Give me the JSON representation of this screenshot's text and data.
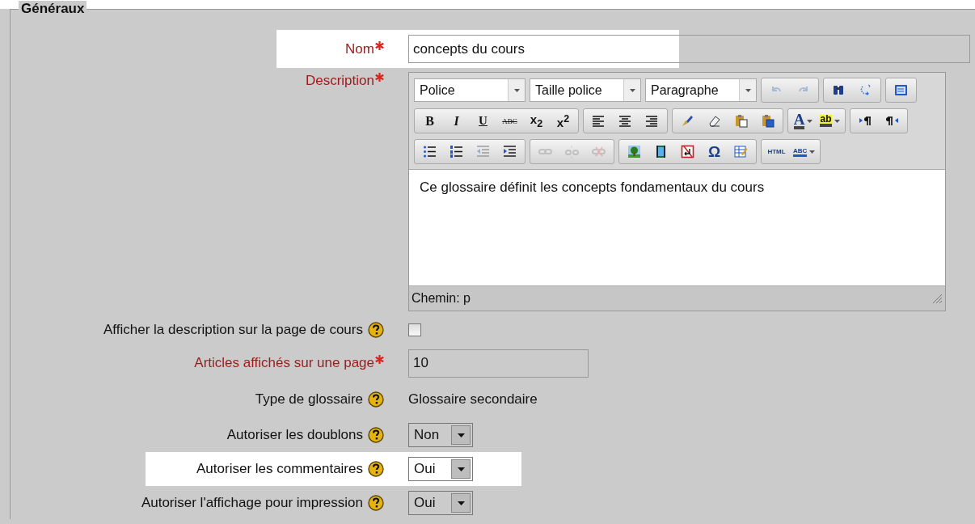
{
  "fieldset": {
    "legend": "Généraux"
  },
  "rows": [
    {
      "kind": "text",
      "label": "Nom",
      "required": true,
      "help": false,
      "highlighted": true,
      "value": "concepts du cours"
    },
    {
      "kind": "editor",
      "label": "Description",
      "required": true,
      "help": false,
      "highlighted": false,
      "editor": {
        "toolbar": [
          [
            {
              "kind": "select",
              "label": "Police"
            },
            {
              "kind": "select",
              "label": "Taille police"
            },
            {
              "kind": "select",
              "label": "Paragraphe"
            },
            {
              "kind": "group",
              "buttons": [
                {
                  "kind": "icon",
                  "disabled": true,
                  "menu": false
                },
                {
                  "kind": "icon",
                  "disabled": true,
                  "menu": false
                }
              ]
            },
            {
              "kind": "group",
              "buttons": [
                {
                  "kind": "icon",
                  "disabled": false,
                  "menu": false
                },
                {
                  "kind": "icon",
                  "disabled": false,
                  "menu": false
                }
              ]
            },
            {
              "kind": "group",
              "buttons": [
                {
                  "kind": "icon",
                  "disabled": false,
                  "menu": false
                }
              ]
            }
          ],
          [
            {
              "kind": "group",
              "buttons": [
                {
                  "kind": "text",
                  "label": "B",
                  "disabled": false,
                  "menu": false
                },
                {
                  "kind": "text",
                  "label": "I",
                  "disabled": false,
                  "menu": false
                },
                {
                  "kind": "text",
                  "label": "U",
                  "disabled": false,
                  "menu": false
                },
                {
                  "kind": "text",
                  "label": "ABC",
                  "disabled": false,
                  "menu": false
                },
                {
                  "kind": "text",
                  "label": "x$_{2}$",
                  "disabled": false,
                  "menu": false
                },
                {
                  "kind": "text",
                  "label": "x$^{2}$",
                  "disabled": false,
                  "menu": false
                }
              ]
            },
            {
              "kind": "group",
              "buttons": [
                {
                  "kind": "icon",
                  "disabled": false,
                  "menu": false
                },
                {
                  "kind": "icon",
                  "disabled": false,
                  "menu": false
                },
                {
                  "kind": "icon",
                  "disabled": false,
                  "menu": false
                }
              ]
            },
            {
              "kind": "group",
              "buttons": [
                {
                  "kind": "icon",
                  "disabled": false,
                  "menu": false
                },
                {
                  "kind": "icon",
                  "disabled": false,
                  "menu": false
                },
                {
                  "kind": "icon",
                  "disabled": false,
                  "menu": false
                },
                {
                  "kind": "icon",
                  "disabled": false,
                  "menu": false
                }
              ]
            },
            {
              "kind": "group",
              "buttons": [
                {
                  "kind": "text",
                  "label": "A",
                  "disabled": false,
                  "menu": true
                },
                {
                  "kind": "text",
                  "label": "ab",
                  "disabled": false,
                  "menu": true
                }
              ]
            },
            {
              "kind": "group",
              "buttons": [
                {
                  "kind": "icon",
                  "disabled": false,
                  "menu": false
                },
                {
                  "kind": "icon",
                  "disabled": false,
                  "menu": false
                }
              ]
            }
          ],
          [
            {
              "kind": "group",
              "buttons": [
                {
                  "kind": "icon",
                  "disabled": false,
                  "menu": false
                },
                {
                  "kind": "icon",
                  "disabled": false,
                  "menu": false
                },
                {
                  "kind": "icon",
                  "disabled": false,
                  "menu": false
                },
                {
                  "kind": "icon",
                  "disabled": false,
                  "menu": false
                }
              ]
            },
            {
              "kind": "group",
              "buttons": [
                {
                  "kind": "icon",
                  "disabled": true,
                  "menu": false
                },
                {
                  "kind": "icon",
                  "disabled": true,
                  "menu": false
                },
                {
                  "kind": "icon",
                  "disabled": true,
                  "menu": false
                }
              ]
            },
            {
              "kind": "group",
              "buttons": [
                {
                  "kind": "icon",
                  "disabled": false,
                  "menu": false
                },
                {
                  "kind": "icon",
                  "disabled": false,
                  "menu": false
                },
                {
                  "kind": "icon",
                  "disabled": false,
                  "menu": false
                },
                {
                  "kind": "text",
                  "label": "Ω",
                  "disabled": false,
                  "menu": false
                },
                {
                  "kind": "icon",
                  "disabled": false,
                  "menu": false
                }
              ]
            },
            {
              "kind": "group",
              "buttons": [
                {
                  "kind": "text",
                  "label": "HTML",
                  "disabled": false,
                  "menu": false
                },
                {
                  "kind": "text",
                  "label": "ABC",
                  "disabled": false,
                  "menu": true
                }
              ]
            }
          ]
        ],
        "content": "Ce glossaire définit les concepts fondamentaux du cours",
        "path": "Chemin: p"
      }
    },
    {
      "kind": "checkbox",
      "label": "Afficher la description sur la page de cours",
      "required": false,
      "help": true,
      "highlighted": false,
      "checked": false
    },
    {
      "kind": "number",
      "label": "Articles affichés sur une page",
      "required": true,
      "help": false,
      "highlighted": false,
      "value": "10"
    },
    {
      "kind": "static",
      "label": "Type de glossaire",
      "required": false,
      "help": true,
      "highlighted": false,
      "value": "Glossaire secondaire"
    },
    {
      "kind": "select",
      "label": "Autoriser les doublons",
      "required": false,
      "help": true,
      "highlighted": false,
      "value": "Non"
    },
    {
      "kind": "select",
      "label": "Autoriser les commentaires",
      "required": false,
      "help": true,
      "highlighted": true,
      "value": "Oui"
    },
    {
      "kind": "select",
      "label": "Autoriser l'affichage pour impression",
      "required": false,
      "help": true,
      "highlighted": false,
      "value": "Oui"
    }
  ]
}
